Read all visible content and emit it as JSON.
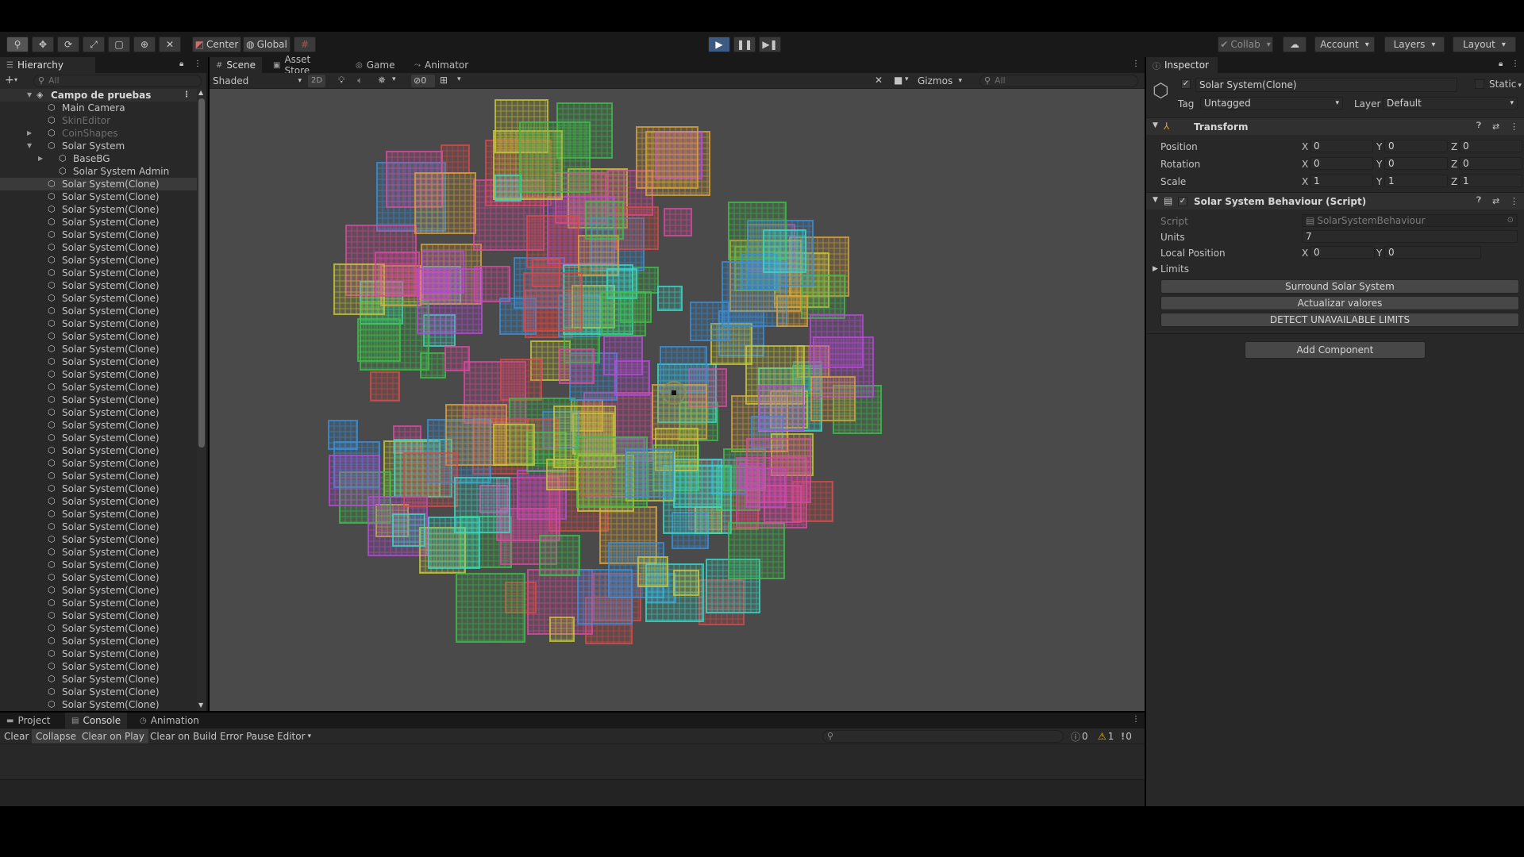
{
  "toolbar": {
    "tools": [
      "view-tool",
      "move-tool",
      "rotate-tool",
      "scale-tool",
      "rect-tool",
      "transform-tool",
      "custom-tool"
    ],
    "pivot_mode": "Center",
    "pivot_rotation": "Global",
    "collab": "Collab",
    "account": "Account",
    "layers": "Layers",
    "layout": "Layout",
    "accent_play": "#3d5a85"
  },
  "hierarchy": {
    "tab": "Hierarchy",
    "search_placeholder": "All",
    "scene_name": "Campo de pruebas",
    "items": [
      {
        "label": "Main Camera",
        "indent": 1,
        "dim": false,
        "arrow": ""
      },
      {
        "label": "SkinEditor",
        "indent": 1,
        "dim": true,
        "arrow": ""
      },
      {
        "label": "CoinShapes",
        "indent": 1,
        "dim": true,
        "arrow": "▶"
      },
      {
        "label": "Solar System",
        "indent": 1,
        "dim": false,
        "arrow": "▼"
      },
      {
        "label": "BaseBG",
        "indent": 2,
        "dim": false,
        "arrow": "▶"
      },
      {
        "label": "Solar System Admin",
        "indent": 2,
        "dim": false,
        "arrow": ""
      }
    ],
    "clone_label": "Solar System(Clone)",
    "clone_count": 42
  },
  "scene": {
    "tabs": [
      "Scene",
      "Asset Store",
      "Game",
      "Animator"
    ],
    "shading": "Shaded",
    "mode_2d": "2D",
    "hidden_count": "0",
    "gizmos": "Gizmos",
    "search_placeholder": "All"
  },
  "inspector": {
    "tab": "Inspector",
    "object_name": "Solar System(Clone)",
    "static_label": "Static",
    "tag_label": "Tag",
    "tag_value": "Untagged",
    "layer_label": "Layer",
    "layer_value": "Default",
    "transform": {
      "title": "Transform",
      "position_label": "Position",
      "rotation_label": "Rotation",
      "scale_label": "Scale",
      "position": [
        "0",
        "0",
        "0"
      ],
      "rotation": [
        "0",
        "0",
        "0"
      ],
      "scale": [
        "1",
        "1",
        "1"
      ]
    },
    "script_component": {
      "title": "Solar System Behaviour (Script)",
      "script_label": "Script",
      "script_value": "SolarSystemBehaviour",
      "units_label": "Units",
      "units_value": "7",
      "local_position_label": "Local Position",
      "local_position": [
        "0",
        "0"
      ],
      "limits_label": "Limits"
    },
    "buttons": {
      "surround": "Surround Solar System",
      "update": "Actualizar valores",
      "detect": "DETECT UNAVAILABLE LIMITS",
      "add_component": "Add Component"
    }
  },
  "console": {
    "tabs": [
      "Project",
      "Console",
      "Animation"
    ],
    "buttons": [
      "Clear",
      "Collapse",
      "Clear on Play",
      "Clear on Build",
      "Error Pause",
      "Editor"
    ],
    "counts": {
      "log": "0",
      "warn": "1",
      "error": "0"
    }
  }
}
